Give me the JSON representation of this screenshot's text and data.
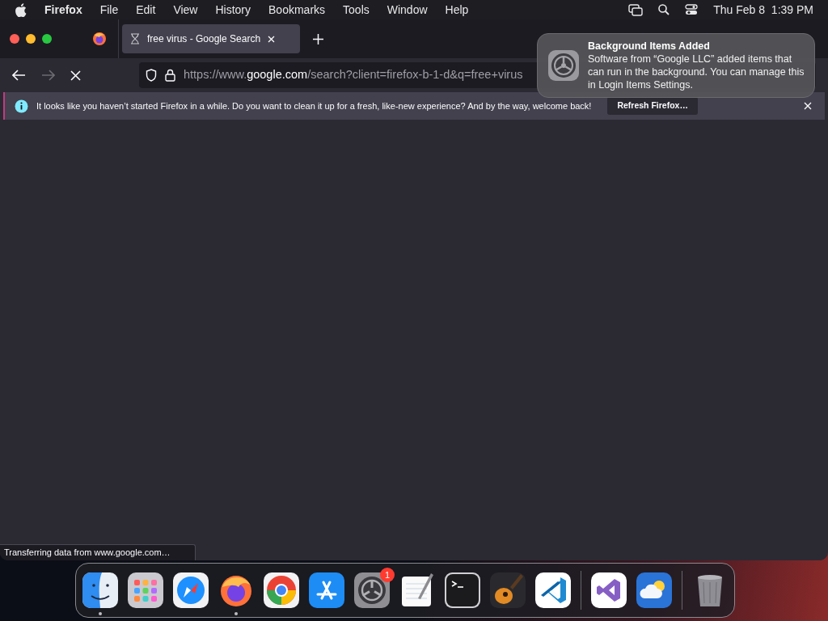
{
  "menu_bar": {
    "app": "Firefox",
    "items": [
      "File",
      "Edit",
      "View",
      "History",
      "Bookmarks",
      "Tools",
      "Window",
      "Help"
    ],
    "clock": "Thu Feb 8  1:39 PM"
  },
  "tabs": [
    {
      "title": "free virus - Google Search",
      "selected": true,
      "loading": true
    }
  ],
  "toolbar": {
    "url": "https://www.**google.com**/search?client=firefox-b-1-d&q=free+virus",
    "forward_disabled": true
  },
  "info_bar": {
    "message": "It looks like you haven’t started Firefox in a while. Do you want to clean it up for a fresh, like-new experience? And by the way, welcome back!",
    "button": "Refresh Firefox…"
  },
  "notification": {
    "title": "Background Items Added",
    "body": "Software from “Google LLC” added items that can run in the background. You can manage this in Login Items Settings."
  },
  "status": "Transferring data from www.google.com…",
  "dock": [
    {
      "kind": "finder",
      "running": true
    },
    {
      "kind": "launchpad",
      "running": false
    },
    {
      "kind": "safari",
      "running": false
    },
    {
      "kind": "firefox",
      "running": true
    },
    {
      "kind": "chrome",
      "running": false
    },
    {
      "kind": "appstore",
      "running": false
    },
    {
      "kind": "settings",
      "running": false,
      "badge": "1"
    },
    {
      "kind": "textedit",
      "running": false
    },
    {
      "kind": "terminal",
      "running": false
    },
    {
      "kind": "guitar",
      "running": false
    },
    {
      "kind": "vscode",
      "running": false
    },
    {
      "kind": "separator"
    },
    {
      "kind": "vstudio",
      "running": false
    },
    {
      "kind": "weather",
      "running": false
    },
    {
      "kind": "separator"
    },
    {
      "kind": "trash",
      "running": false
    }
  ]
}
